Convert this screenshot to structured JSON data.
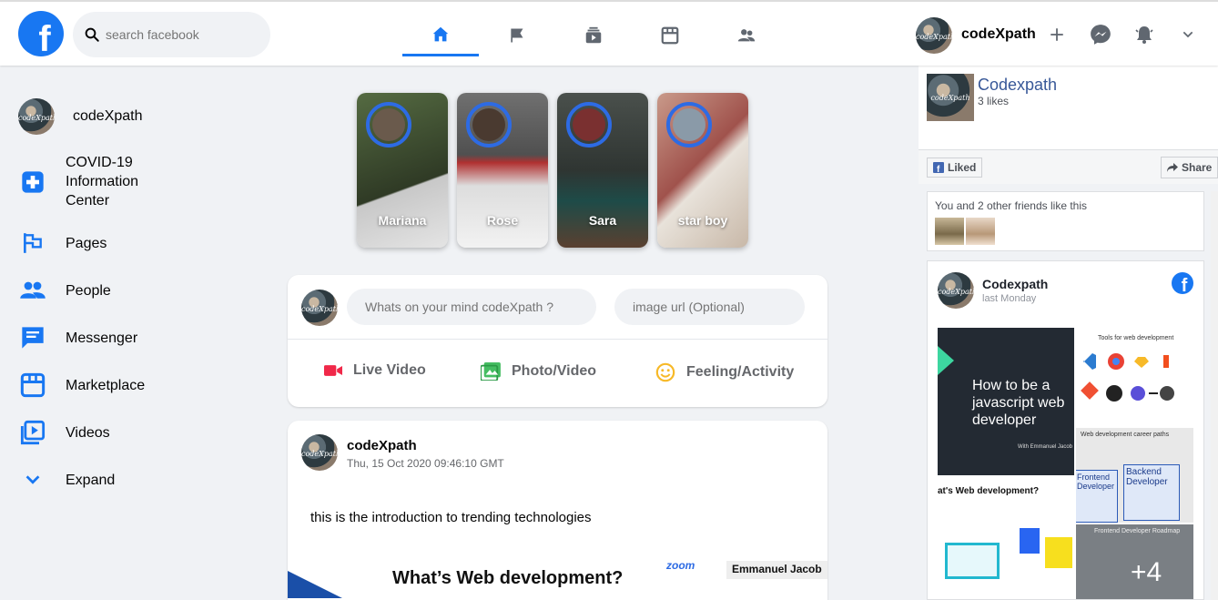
{
  "header": {
    "logo_letter": "f",
    "search_placeholder": "search facebook",
    "user_name": "codeXpath",
    "nav_tabs": [
      "home-icon",
      "flag-icon",
      "video-icon",
      "marketplace-icon",
      "groups-icon"
    ]
  },
  "sidebar": {
    "user_name": "codeXpath",
    "items": [
      {
        "label": "COVID-19 Information Center",
        "icon": "plus-square-icon"
      },
      {
        "label": "Pages",
        "icon": "flag-icon"
      },
      {
        "label": "People",
        "icon": "people-icon"
      },
      {
        "label": "Messenger",
        "icon": "message-icon"
      },
      {
        "label": "Marketplace",
        "icon": "store-icon"
      },
      {
        "label": "Videos",
        "icon": "video-icon"
      },
      {
        "label": "Expand",
        "icon": "chevron-down-icon"
      }
    ]
  },
  "stories": [
    {
      "name": "Mariana",
      "color": "#4a5a3a"
    },
    {
      "name": "Rose",
      "color": "#5a5a5a"
    },
    {
      "name": "Sara",
      "color": "#3a3f3c"
    },
    {
      "name": "star boy",
      "color": "#b8827a"
    }
  ],
  "composer": {
    "post_placeholder": "Whats on your mind codeXpath ?",
    "image_placeholder": "image url (Optional)",
    "actions": [
      {
        "label": "Live Video",
        "color": "#f02849"
      },
      {
        "label": "Photo/Video",
        "color": "#45bd62"
      },
      {
        "label": "Feeling/Activity",
        "color": "#f7b928"
      }
    ]
  },
  "post": {
    "author": "codeXpath",
    "timestamp": "Thu, 15 Oct 2020 09:46:10 GMT",
    "text": "this is the introduction to trending technologies",
    "image_title": "What’s Web development?",
    "image_brand": "zoom",
    "image_presenter": "Emmanuel Jacob"
  },
  "right_panel": {
    "page_name": "Codexpath",
    "page_likes": "3 likes",
    "liked_label": "Liked",
    "share_label": "Share",
    "friends_text": "You and 2 other friends like this",
    "feed": {
      "author": "Codexpath",
      "date": "last Monday",
      "tile1_title": "How to be a javascript web developer",
      "tile1_sub": "With Emmanuel Jacob",
      "tile2_title": "Tools for web development",
      "tile3_title": "Web development career paths",
      "tile3_front": "Frontend Developer",
      "tile3_back": "Backend Developer",
      "tile4_title": "at's Web development?",
      "tile5_title": "Frontend Developer Roadmap",
      "more_count": "+4"
    }
  }
}
